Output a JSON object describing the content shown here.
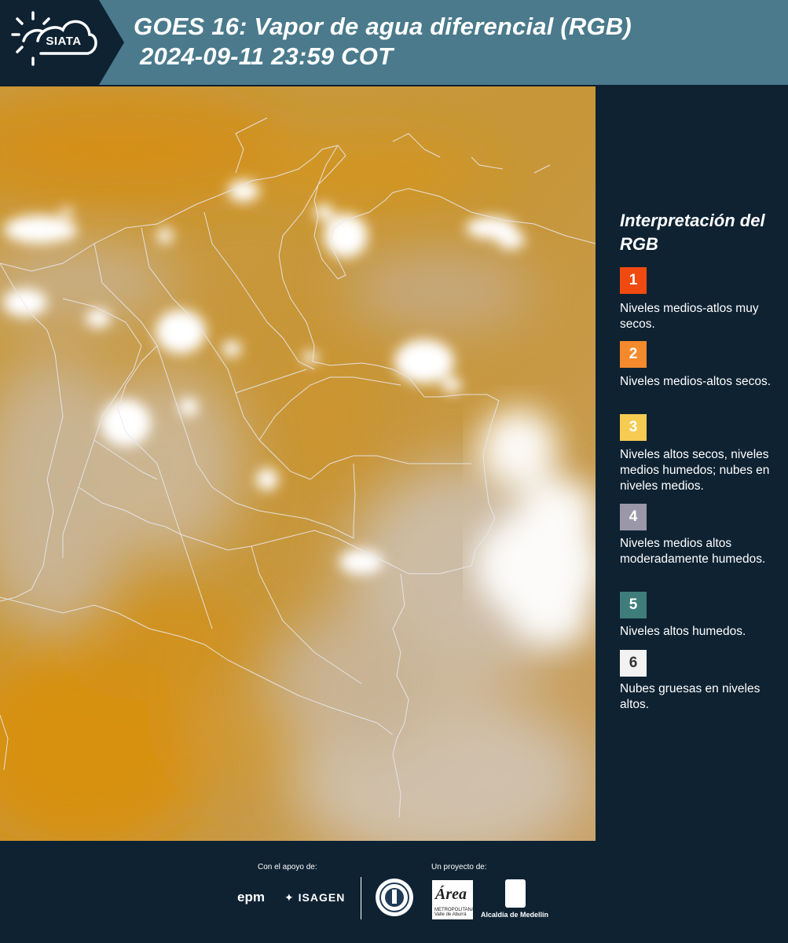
{
  "header": {
    "logo_text": "SIATA",
    "title_line1": "GOES 16: Vapor de agua diferencial (RGB)",
    "title_line2": "2024-09-11 23:59 COT"
  },
  "legend": {
    "title": "Interpretación del RGB",
    "items": [
      {
        "number": "1",
        "color": "#f04a10",
        "text_color": "#ffffff",
        "label": "Niveles medios-atlos muy secos."
      },
      {
        "number": "2",
        "color": "#f58a2c",
        "text_color": "#ffffff",
        "label": "Niveles medios-altos secos."
      },
      {
        "number": "3",
        "color": "#f6cb52",
        "text_color": "#ffffff",
        "label": "Niveles altos secos, niveles medios humedos; nubes en niveles medios."
      },
      {
        "number": "4",
        "color": "#9a98a8",
        "text_color": "#ffffff",
        "label": "Niveles medios altos moderadamente humedos."
      },
      {
        "number": "5",
        "color": "#3f7d7b",
        "text_color": "#ffffff",
        "label": "Niveles altos humedos."
      },
      {
        "number": "6",
        "color": "#f2f2f2",
        "text_color": "#333333",
        "label": "Nubes gruesas en niveles altos."
      }
    ]
  },
  "footer": {
    "support_label": "Con el apoyo de:",
    "project_label": "Un proyecto de:",
    "sponsor_1": "epm",
    "sponsor_2": "ISAGEN",
    "area_logo_text": "Área",
    "area_logo_sub": "METROPOLITANA Valle de Aburrá",
    "alcaldia_label": "Alcaldía de Medellín"
  },
  "colors": {
    "header_bg": "#4a7a8c",
    "panel_bg": "#0e2232",
    "map_dry": "#c9912a"
  }
}
